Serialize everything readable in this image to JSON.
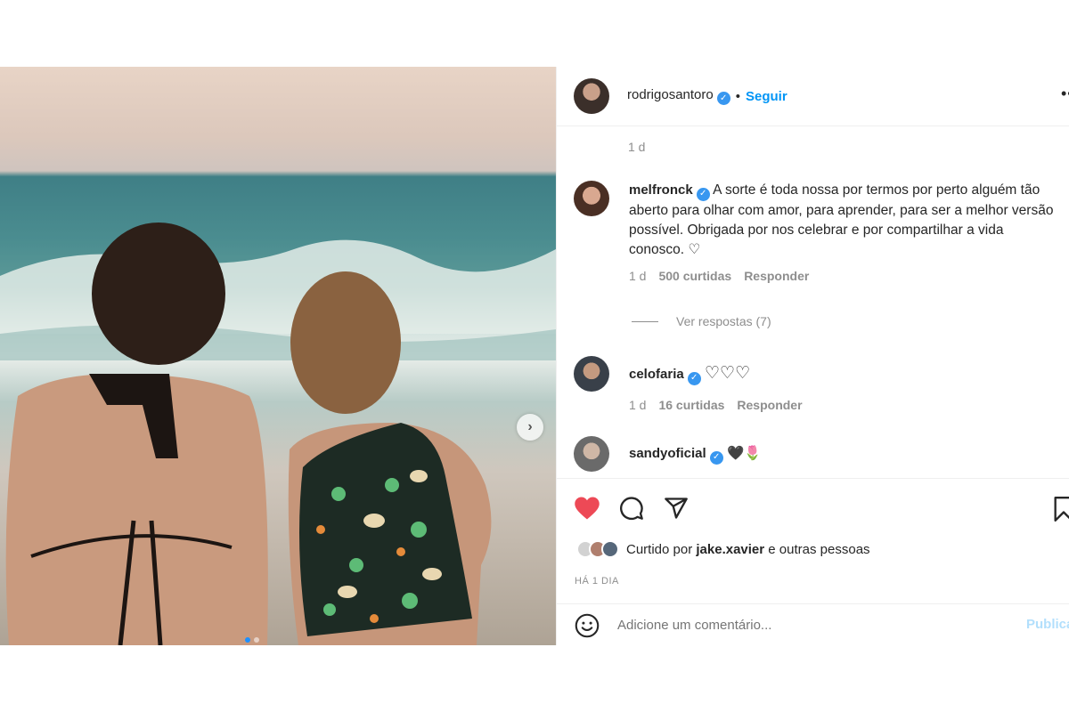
{
  "post": {
    "author": "rodrigosantoro",
    "separator": "•",
    "follow_label": "Seguir",
    "more_label": "•••",
    "time": "1 d"
  },
  "comments": [
    {
      "user": "melfronck",
      "text": "A sorte é toda nossa por termos por perto alguém tão aberto para olhar com amor, para aprender, para ser a melhor versão possível. Obrigada por nos celebrar e por compartilhar a vida conosco. ♡",
      "time": "1 d",
      "likes": "500 curtidas",
      "reply": "Responder",
      "view_replies": "Ver respostas (7)"
    },
    {
      "user": "celofaria",
      "text": "♡♡♡",
      "time": "1 d",
      "likes": "16 curtidas",
      "reply": "Responder"
    },
    {
      "user": "sandyoficial",
      "text": "🖤🌷"
    }
  ],
  "liked_by": {
    "prefix": "Curtido por",
    "user": "jake.xavier",
    "suffix": "e outras pessoas"
  },
  "ago": "HÁ 1 DIA",
  "add_comment": {
    "placeholder": "Adicione um comentário...",
    "publish_label": "Publicar"
  },
  "colors": {
    "accent": "#0095f6",
    "like_red": "#ed4956",
    "verified": "#3897f0"
  },
  "carousel": {
    "slides": 2,
    "active": 1
  }
}
